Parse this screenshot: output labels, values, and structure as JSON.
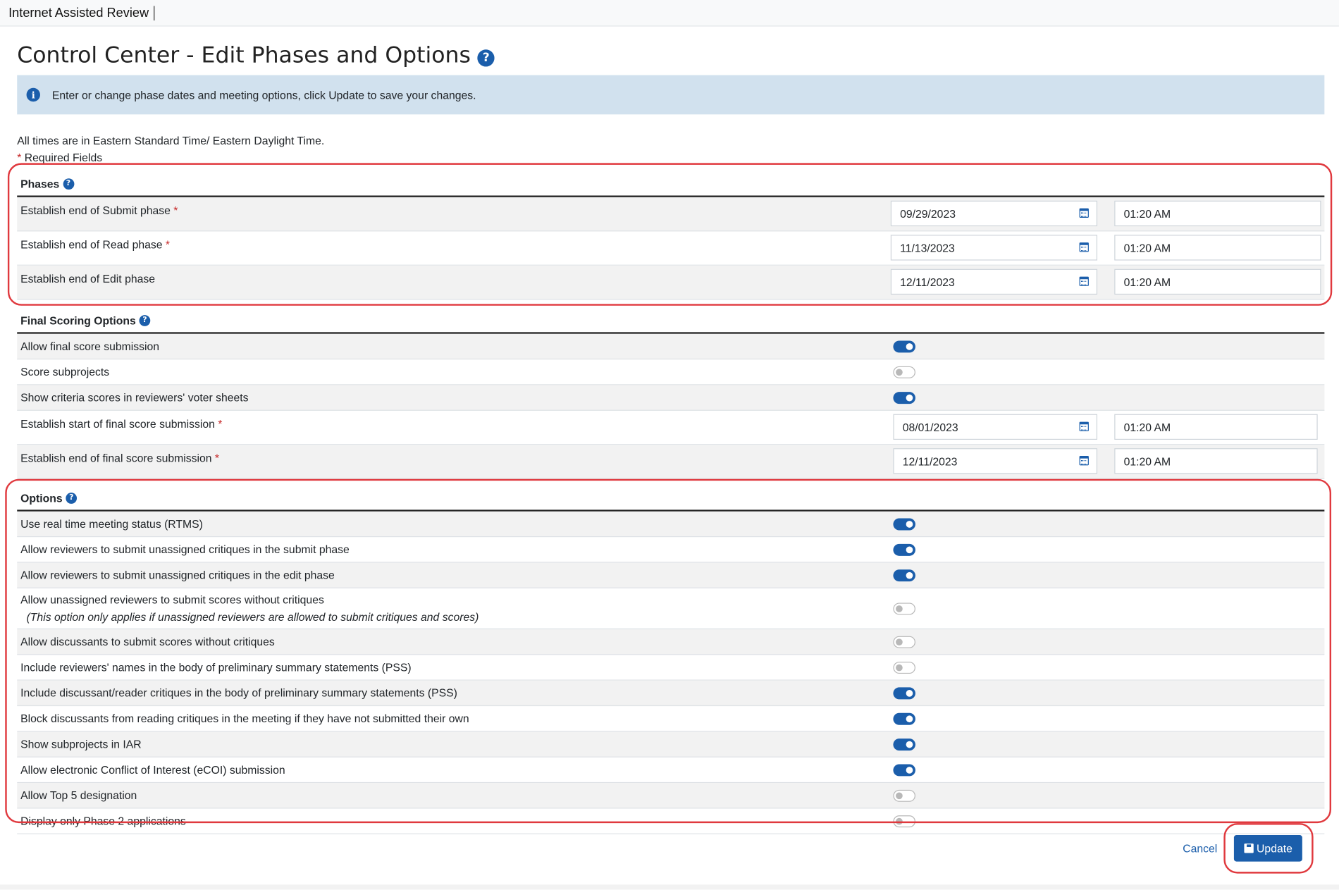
{
  "app": {
    "title": "Internet Assisted Review"
  },
  "page": {
    "title": "Control Center - Edit Phases and Options"
  },
  "alert": {
    "text": "Enter or change phase dates and meeting options, click Update to save your changes."
  },
  "notes": {
    "timezone": "All times are in Eastern Standard Time/ Eastern Daylight Time.",
    "required_star": "*",
    "required": "Required Fields"
  },
  "phases": {
    "title": "Phases",
    "rows": [
      {
        "label": "Establish end of Submit phase",
        "required": true,
        "date": "09/29/2023",
        "time": "01:20 AM"
      },
      {
        "label": "Establish end of Read phase",
        "required": true,
        "date": "11/13/2023",
        "time": "01:20 AM"
      },
      {
        "label": "Establish end of Edit phase",
        "required": false,
        "date": "12/11/2023",
        "time": "01:20 AM"
      }
    ]
  },
  "final_scoring": {
    "title": "Final Scoring Options",
    "toggles": [
      {
        "label": "Allow final score submission",
        "on": true
      },
      {
        "label": "Score subprojects",
        "on": false
      },
      {
        "label": "Show criteria scores in reviewers' voter sheets",
        "on": true
      }
    ],
    "dates": [
      {
        "label": "Establish start of final score submission",
        "required": true,
        "date": "08/01/2023",
        "time": "01:20 AM"
      },
      {
        "label": "Establish end of final score submission",
        "required": true,
        "date": "12/11/2023",
        "time": "01:20 AM"
      }
    ]
  },
  "options": {
    "title": "Options",
    "rows": [
      {
        "label": "Use real time meeting status (RTMS)",
        "on": true
      },
      {
        "label": "Allow reviewers to submit unassigned critiques in the submit phase",
        "on": true
      },
      {
        "label": "Allow reviewers to submit unassigned critiques in the edit phase",
        "on": true
      },
      {
        "label": "Allow unassigned reviewers to submit scores without critiques",
        "sub": "(This option only applies if unassigned reviewers are allowed to submit critiques and scores)",
        "on": false
      },
      {
        "label": "Allow discussants to submit scores without critiques",
        "on": false
      },
      {
        "label": "Include reviewers' names in the body of preliminary summary statements (PSS)",
        "on": false
      },
      {
        "label": "Include discussant/reader critiques in the body of preliminary summary statements (PSS)",
        "on": true
      },
      {
        "label": "Block discussants from reading critiques in the meeting if they have not submitted their own",
        "on": true
      },
      {
        "label": "Show subprojects in IAR",
        "on": true
      },
      {
        "label": "Allow electronic Conflict of Interest (eCOI) submission",
        "on": true
      },
      {
        "label": "Allow Top 5 designation",
        "on": false
      },
      {
        "label": "Display only Phase 2 applications",
        "on": false
      }
    ]
  },
  "actions": {
    "cancel": "Cancel",
    "update": "Update"
  },
  "colors": {
    "primary": "#1b5eab",
    "alert_bg": "#d1e1ee",
    "required": "#c62828",
    "highlight": "#e0393e"
  }
}
